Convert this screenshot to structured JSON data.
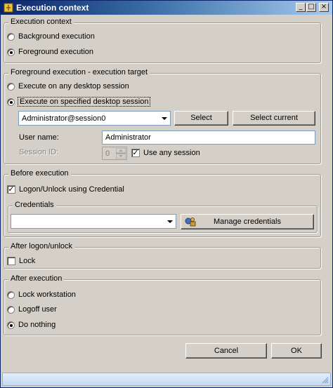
{
  "window": {
    "title": "Execution context"
  },
  "execution_context": {
    "legend": "Execution context",
    "options": [
      {
        "label": "Background execution",
        "selected": false
      },
      {
        "label": "Foreground execution",
        "selected": true
      }
    ]
  },
  "target": {
    "legend": "Foreground execution - execution target",
    "any_session_label": "Execute on any desktop session",
    "specified_session_label": "Execute on specified desktop session",
    "session_value": "Administrator@session0",
    "select_label": "Select",
    "select_current_label": "Select current",
    "user_name_label": "User name:",
    "user_name_value": "Administrator",
    "session_id_label": "Session ID:",
    "session_id_value": "0",
    "use_any_session_label": "Use any session"
  },
  "before": {
    "legend": "Before execution",
    "logon_label": "Logon/Unlock using Credential",
    "credentials_legend": "Credentials",
    "credentials_value": "",
    "manage_label": "Manage credentials"
  },
  "after_logon": {
    "legend": "After logon/unlock",
    "lock_label": "Lock"
  },
  "after_exec": {
    "legend": "After execution",
    "options": [
      {
        "label": "Lock workstation",
        "selected": false
      },
      {
        "label": "Logoff user",
        "selected": false
      },
      {
        "label": "Do nothing",
        "selected": true
      }
    ]
  },
  "footer": {
    "cancel_label": "Cancel",
    "ok_label": "OK"
  }
}
